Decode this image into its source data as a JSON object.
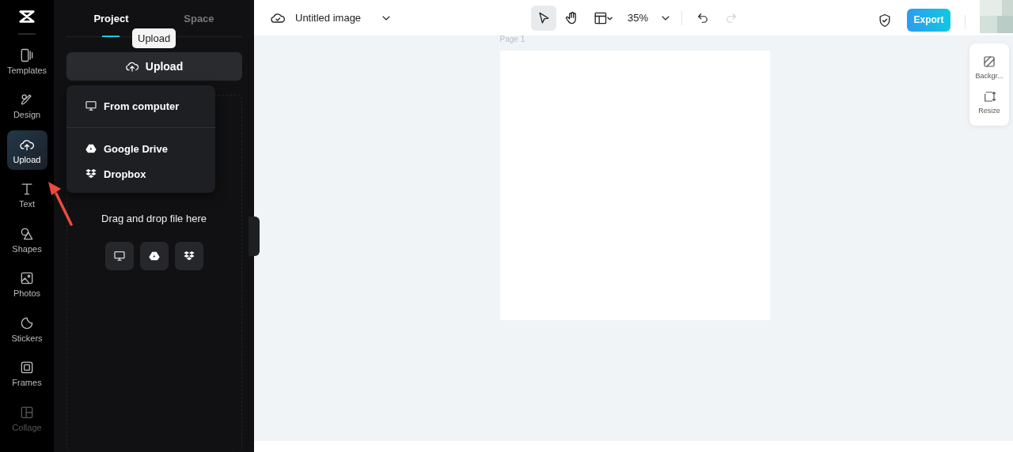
{
  "rail": {
    "items": [
      {
        "label": "Templates",
        "kind": "templates",
        "selected": false
      },
      {
        "label": "Design",
        "kind": "design",
        "selected": false
      },
      {
        "label": "Upload",
        "kind": "upload",
        "selected": true
      },
      {
        "label": "Text",
        "kind": "text",
        "selected": false
      },
      {
        "label": "Shapes",
        "kind": "shapes",
        "selected": false
      },
      {
        "label": "Photos",
        "kind": "photos",
        "selected": false
      },
      {
        "label": "Stickers",
        "kind": "stickers",
        "selected": false
      },
      {
        "label": "Frames",
        "kind": "frames",
        "selected": false
      },
      {
        "label": "Collage",
        "kind": "collage",
        "selected": false
      }
    ]
  },
  "panel": {
    "tabs": [
      {
        "label": "Project",
        "selected": true
      },
      {
        "label": "Space",
        "selected": false
      }
    ],
    "tooltip": "Upload",
    "upload_button": "Upload",
    "upload_menu": [
      {
        "label": "From computer",
        "kind": "computer"
      },
      {
        "label": "Google Drive",
        "kind": "drive"
      },
      {
        "label": "Dropbox",
        "kind": "dropbox"
      }
    ],
    "drop_hint": "Drag and drop file here",
    "sources": [
      {
        "kind": "computer"
      },
      {
        "kind": "drive"
      },
      {
        "kind": "dropbox"
      }
    ]
  },
  "toolbar": {
    "title": "Untitled image",
    "tools": [
      {
        "kind": "select",
        "selected": true
      },
      {
        "kind": "hand",
        "selected": false
      }
    ],
    "zoom": "35%",
    "redo_disabled": true,
    "export": "Export"
  },
  "canvas": {
    "page_label": "Page 1"
  },
  "side_tools": [
    {
      "label": "Backgr...",
      "kind": "background"
    },
    {
      "label": "Resize",
      "kind": "resize"
    }
  ]
}
